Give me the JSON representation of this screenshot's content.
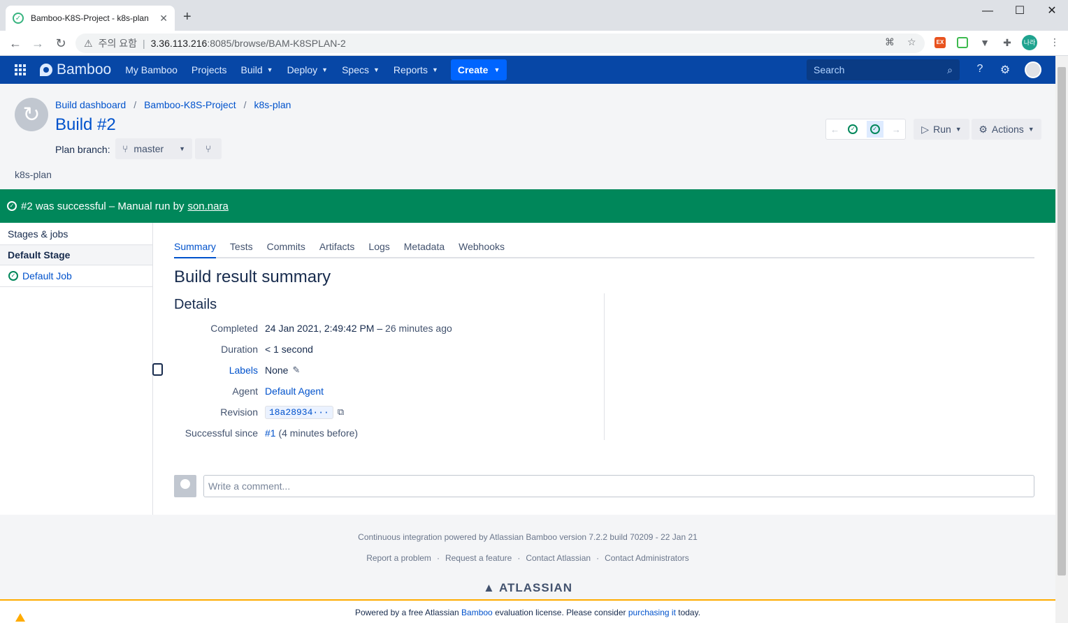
{
  "browser": {
    "tab_title": "Bamboo-K8S-Project - k8s-plan",
    "security_label": "주의 요함",
    "url_host": "3.36.113.216",
    "url_path": ":8085/browse/BAM-K8SPLAN-2",
    "profile_initials": "나라"
  },
  "nav": {
    "logo": "Bamboo",
    "items": [
      "My Bamboo",
      "Projects",
      "Build",
      "Deploy",
      "Specs",
      "Reports"
    ],
    "create_label": "Create",
    "search_placeholder": "Search"
  },
  "header": {
    "breadcrumb": [
      "Build dashboard",
      "Bamboo-K8S-Project",
      "k8s-plan"
    ],
    "title": "Build #2",
    "plan_branch_label": "Plan branch:",
    "branch": "master",
    "plan_description": "k8s-plan",
    "run_label": "Run",
    "actions_label": "Actions"
  },
  "banner": {
    "text": "#2 was successful – Manual run by",
    "user": "son.nara"
  },
  "sidebar": {
    "heading": "Stages & jobs",
    "stage": "Default Stage",
    "job": "Default Job"
  },
  "tabs": [
    "Summary",
    "Tests",
    "Commits",
    "Artifacts",
    "Logs",
    "Metadata",
    "Webhooks"
  ],
  "summary": {
    "title": "Build result summary",
    "details_title": "Details",
    "completed_label": "Completed",
    "completed_value": "24 Jan 2021, 2:49:42 PM",
    "completed_sep": " – ",
    "completed_ago": "26 minutes ago",
    "duration_label": "Duration",
    "duration_value": "< 1 second",
    "labels_label": "Labels",
    "labels_value": "None",
    "agent_label": "Agent",
    "agent_value": "Default Agent",
    "revision_label": "Revision",
    "revision_value": "18a28934···",
    "since_label": "Successful since",
    "since_build": "#1",
    "since_note": " (4 minutes before)"
  },
  "comment": {
    "placeholder": "Write a comment..."
  },
  "footer": {
    "powered": "Continuous integration powered by Atlassian Bamboo version 7.2.2 build 70209 - 22 Jan 21",
    "links": [
      "Report a problem",
      "Request a feature",
      "Contact Atlassian",
      "Contact Administrators"
    ],
    "atlassian": "ATLASSIAN",
    "license_pre": "Powered by a free Atlassian ",
    "license_bamboo": "Bamboo",
    "license_mid": " evaluation license. Please consider ",
    "license_link": "purchasing it",
    "license_post": " today."
  },
  "colors": {
    "header_bg": "#0747a6",
    "create_bg": "#0065ff",
    "success_bg": "#00875a",
    "link": "#0052cc"
  }
}
